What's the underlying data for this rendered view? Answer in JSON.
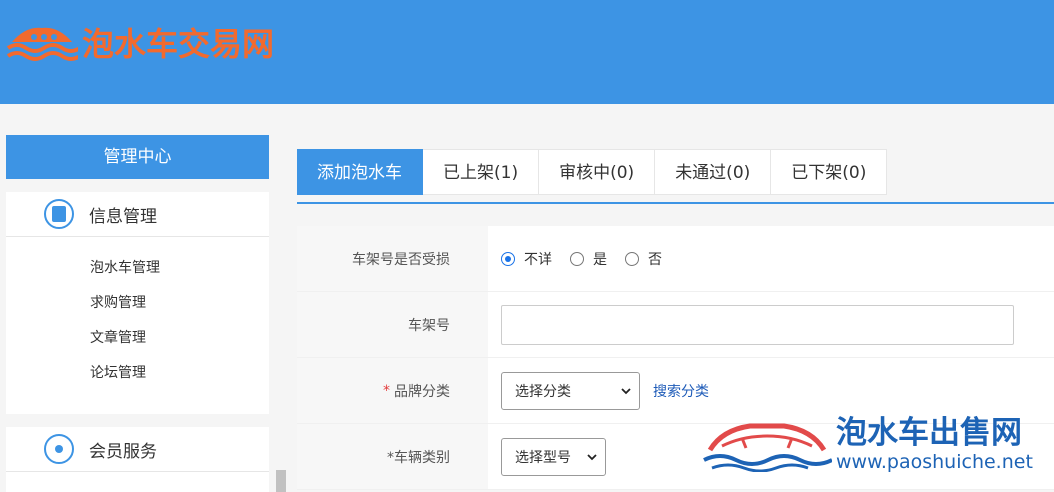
{
  "site": {
    "logo_text": "泡水车交易网"
  },
  "sidebar": {
    "title": "管理中心",
    "sections": [
      {
        "label": "信息管理",
        "icon": "document-icon",
        "items": [
          "泡水车管理",
          "求购管理",
          "文章管理",
          "论坛管理"
        ]
      },
      {
        "label": "会员服务",
        "icon": "user-icon",
        "items": []
      }
    ]
  },
  "tabs": [
    "添加泡水车",
    "已上架(1)",
    "审核中(0)",
    "未通过(0)",
    "已下架(0)"
  ],
  "form": {
    "frame_damage": {
      "label": "车架号是否受损",
      "options": [
        "不详",
        "是",
        "否"
      ],
      "selected": "不详"
    },
    "vin": {
      "label": "车架号",
      "value": ""
    },
    "brand": {
      "required_mark": "*",
      "label": "品牌分类",
      "selected": "选择分类",
      "search_link": "搜索分类"
    },
    "vehicle_type": {
      "label": "*车辆类别",
      "selected": "选择型号"
    }
  },
  "watermark": {
    "title": "泡水车出售网",
    "url": "www.paoshuiche.net"
  },
  "colors": {
    "primary": "#3d94e4",
    "logo": "#f26a2e",
    "required": "#e23b3b",
    "link": "#1e5bb8"
  }
}
